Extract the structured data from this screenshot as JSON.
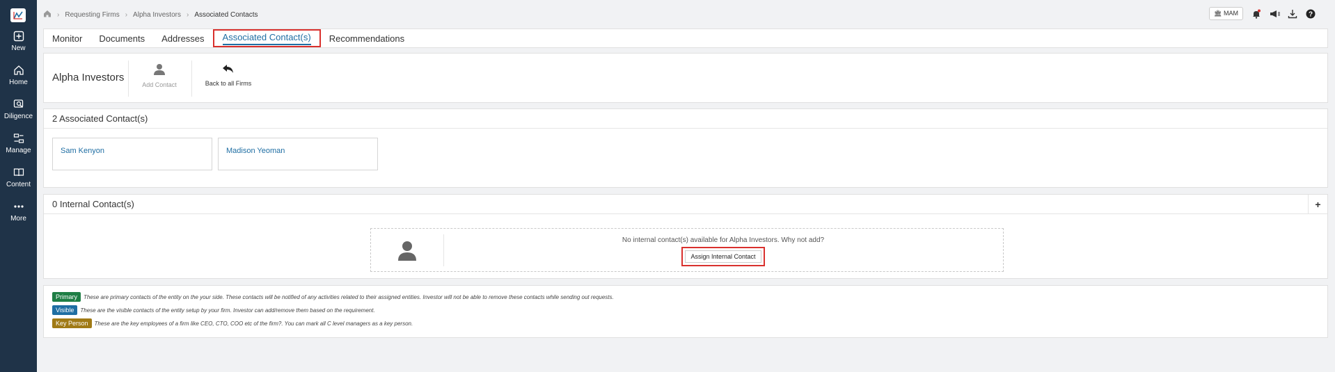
{
  "sidebar": {
    "items": [
      {
        "label": "New",
        "icon": "plus-square-icon"
      },
      {
        "label": "Home",
        "icon": "home-icon"
      },
      {
        "label": "Diligence",
        "icon": "diligence-icon"
      },
      {
        "label": "Manage",
        "icon": "manage-icon"
      },
      {
        "label": "Content",
        "icon": "book-icon"
      },
      {
        "label": "More",
        "icon": "more-dots-icon"
      }
    ]
  },
  "breadcrumb": {
    "items": [
      "Requesting Firms",
      "Alpha Investors",
      "Associated Contacts"
    ]
  },
  "topbar": {
    "mam_label": "MAM"
  },
  "tabs": {
    "items": [
      "Monitor",
      "Documents",
      "Addresses",
      "Associated Contact(s)",
      "Recommendations"
    ],
    "active": "Associated Contact(s)"
  },
  "header": {
    "entity_name": "Alpha Investors",
    "add_contact_label": "Add Contact",
    "back_label": "Back to all Firms"
  },
  "associated": {
    "title": "2 Associated Contact(s)",
    "contacts": [
      "Sam Kenyon",
      "Madison Yeoman"
    ]
  },
  "internal": {
    "title": "0 Internal Contact(s)",
    "add_symbol": "+",
    "empty_message": "No internal contact(s) available for Alpha Investors. Why not add?",
    "assign_label": "Assign Internal Contact"
  },
  "legend": {
    "primary": {
      "badge": "Primary",
      "text": "These are primary contacts of the entity on the your side. These contacts will be notified of any activities related to their assigned entities. Investor will not be able to remove these contacts while sending out requests.",
      "color": "#1e7e45"
    },
    "visible": {
      "badge": "Visible",
      "text": "These are the visible contacts of the entity setup by your firm. Investor can add/remove them based on the requirement.",
      "color": "#1f6ea3"
    },
    "key": {
      "badge": "Key Person",
      "text": "These are the key employees of a firm like CEO, CTO, COO etc of the firm?. You can mark all C level managers as a key person.",
      "color": "#a07a15"
    }
  },
  "colors": {
    "sidebar_bg": "#1f3348",
    "accent": "#1f6ea3",
    "highlight": "#d9302d"
  }
}
